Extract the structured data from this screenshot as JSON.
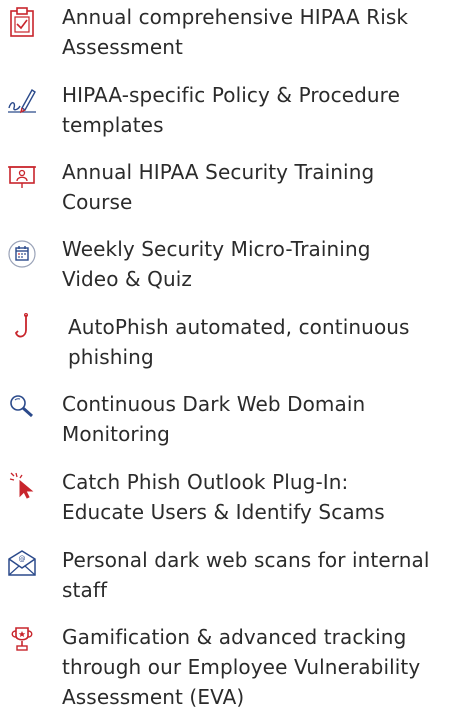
{
  "features": [
    {
      "icon": "clipboard-checklist-icon",
      "lines": [
        "Annual comprehensive HIPAA Risk",
        "Assessment"
      ]
    },
    {
      "icon": "signature-pen-icon",
      "lines": [
        "HIPAA-specific Policy & Procedure",
        "templates"
      ]
    },
    {
      "icon": "presentation-board-icon",
      "lines": [
        "Annual HIPAA Security Training",
        "Course"
      ]
    },
    {
      "icon": "calendar-badge-icon",
      "lines": [
        "Weekly Security Micro-Training",
        "Video & Quiz"
      ]
    },
    {
      "icon": "fishing-hook-icon",
      "lines": [
        "AutoPhish automated, continuous",
        "phishing"
      ]
    },
    {
      "icon": "magnifying-glass-icon",
      "lines": [
        "Continuous Dark Web Domain",
        "Monitoring"
      ]
    },
    {
      "icon": "cursor-click-icon",
      "lines": [
        "Catch Phish Outlook Plug-In:",
        "Educate Users & Identify Scams"
      ]
    },
    {
      "icon": "envelope-at-icon",
      "lines": [
        "Personal dark web scans for internal",
        "staff"
      ]
    },
    {
      "icon": "trophy-icon",
      "lines": [
        "Gamification & advanced tracking",
        "through our Employee Vulnerability",
        "Assessment (EVA)"
      ]
    }
  ],
  "colors": {
    "red": "#c8252c",
    "blue": "#2b4a8b",
    "text": "#2b2b2b"
  }
}
